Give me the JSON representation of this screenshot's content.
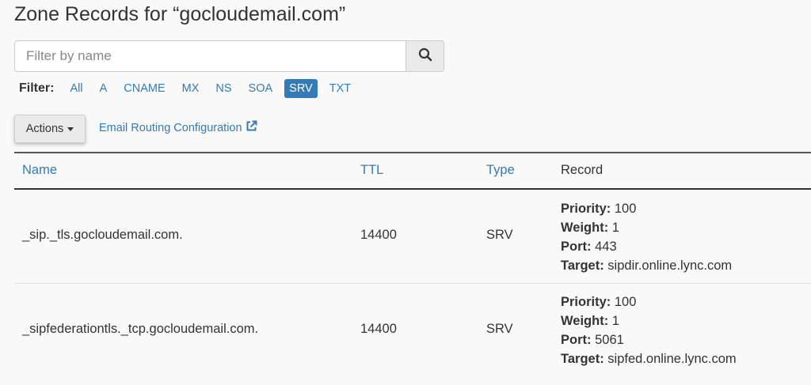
{
  "page_title": "Zone Records for “gocloudemail.com”",
  "search": {
    "placeholder": "Filter by name",
    "value": ""
  },
  "filter": {
    "label": "Filter:",
    "items": [
      "All",
      "A",
      "CNAME",
      "MX",
      "NS",
      "SOA",
      "SRV",
      "TXT"
    ],
    "active": "SRV"
  },
  "actions_label": "Actions",
  "email_routing_label": "Email Routing Configuration",
  "table": {
    "headers": {
      "name": "Name",
      "ttl": "TTL",
      "type": "Type",
      "record": "Record"
    },
    "rows": [
      {
        "name": "_sip._tls.gocloudemail.com.",
        "ttl": "14400",
        "type": "SRV",
        "priority_label": "Priority:",
        "priority": "100",
        "weight_label": "Weight:",
        "weight": "1",
        "port_label": "Port:",
        "port": "443",
        "target_label": "Target:",
        "target": "sipdir.online.lync.com"
      },
      {
        "name": "_sipfederationtls._tcp.gocloudemail.com.",
        "ttl": "14400",
        "type": "SRV",
        "priority_label": "Priority:",
        "priority": "100",
        "weight_label": "Weight:",
        "weight": "1",
        "port_label": "Port:",
        "port": "5061",
        "target_label": "Target:",
        "target": "sipfed.online.lync.com"
      }
    ]
  },
  "colors": {
    "link": "#337ab7",
    "active_filter_bg": "#337ab7",
    "page_bg": "#f9f9f9"
  }
}
